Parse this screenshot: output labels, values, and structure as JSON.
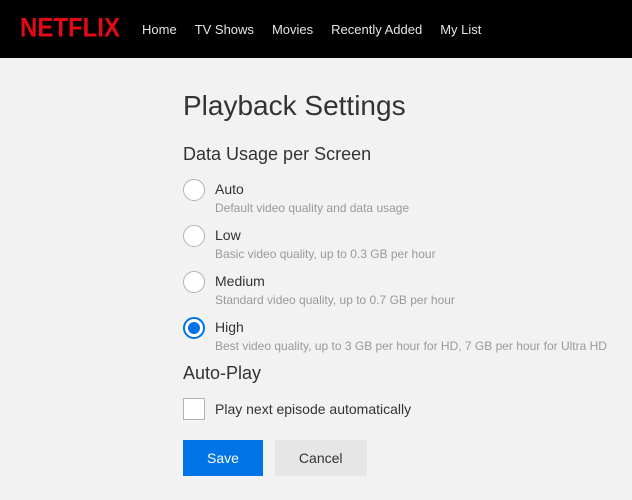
{
  "brand": "NETFLIX",
  "nav": {
    "home": "Home",
    "tv_shows": "TV Shows",
    "movies": "Movies",
    "recently_added": "Recently Added",
    "my_list": "My List"
  },
  "page": {
    "title": "Playback Settings",
    "data_usage_title": "Data Usage per Screen",
    "auto_play_title": "Auto-Play"
  },
  "options": {
    "auto": {
      "label": "Auto",
      "desc": "Default video quality and data usage",
      "selected": false
    },
    "low": {
      "label": "Low",
      "desc": "Basic video quality, up to 0.3 GB per hour",
      "selected": false
    },
    "medium": {
      "label": "Medium",
      "desc": "Standard video quality, up to 0.7 GB per hour",
      "selected": false
    },
    "high": {
      "label": "High",
      "desc": "Best video quality, up to 3 GB per hour for HD, 7 GB per hour for Ultra HD",
      "selected": true
    }
  },
  "autoplay": {
    "label": "Play next episode automatically",
    "checked": false
  },
  "buttons": {
    "save": "Save",
    "cancel": "Cancel"
  }
}
